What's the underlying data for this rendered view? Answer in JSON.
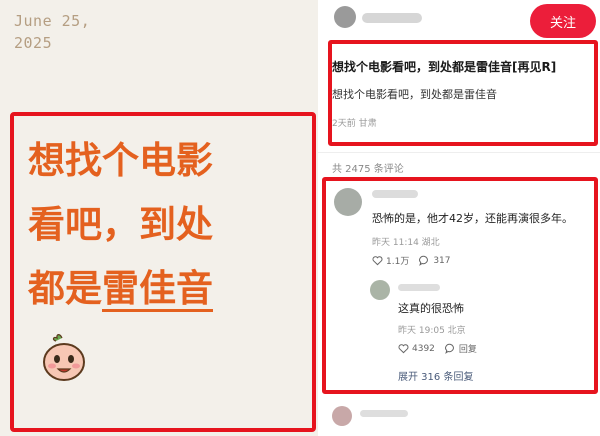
{
  "note": {
    "date_lines": [
      "June 25,",
      "2025"
    ],
    "big_lines": [
      "想找个电影",
      "看吧，到处",
      "都是"
    ],
    "highlight": "雷佳音"
  },
  "post": {
    "follow_label": "关注",
    "title": "想找个电影看吧，到处都是雷佳音[再见R]",
    "body": "想找个电影看吧，到处都是雷佳音",
    "meta": "2天前 甘肃"
  },
  "comments": {
    "count_label": "共 2475 条评论",
    "top": {
      "text": "恐怖的是，他才42岁，还能再演很多年。",
      "time": "昨天 11:14 湖北",
      "likes": "1.1万",
      "replies": "317"
    },
    "reply": {
      "text": "这真的很恐怖",
      "time": "昨天 19:05 北京",
      "likes": "4392",
      "reply_label": "回复"
    },
    "expand_label": "展开 316 条回复"
  },
  "colors": {
    "accent_red": "#e6141e",
    "note_orange": "#e4611f",
    "follow_button": "#ec1e3a"
  },
  "icons": [
    "heart-icon",
    "comment-icon",
    "mascot-icon"
  ]
}
